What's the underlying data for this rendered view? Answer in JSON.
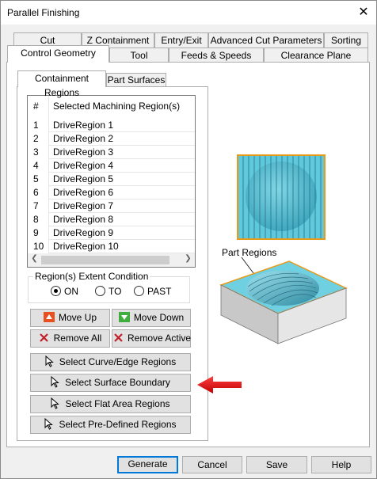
{
  "window": {
    "title": "Parallel Finishing",
    "close_glyph": "✕"
  },
  "tabs_row1": [
    "Cut Parameters",
    "Z Containment",
    "Entry/Exit",
    "Advanced Cut Parameters",
    "Sorting"
  ],
  "tabs_row2": [
    "Control Geometry",
    "Tool",
    "Feeds & Speeds",
    "Clearance Plane"
  ],
  "inner_tabs": [
    "Containment Regions",
    "Part Surfaces"
  ],
  "list": {
    "col_num": "#",
    "col_name": "Selected Machining Region(s)",
    "rows": [
      {
        "num": "1",
        "name": "DriveRegion 1"
      },
      {
        "num": "2",
        "name": "DriveRegion 2"
      },
      {
        "num": "3",
        "name": "DriveRegion 3"
      },
      {
        "num": "4",
        "name": "DriveRegion 4"
      },
      {
        "num": "5",
        "name": "DriveRegion 5"
      },
      {
        "num": "6",
        "name": "DriveRegion 6"
      },
      {
        "num": "7",
        "name": "DriveRegion 7"
      },
      {
        "num": "8",
        "name": "DriveRegion 8"
      },
      {
        "num": "9",
        "name": "DriveRegion 9"
      },
      {
        "num": "10",
        "name": "DriveRegion 10"
      }
    ]
  },
  "extent": {
    "legend": "Region(s) Extent Condition",
    "options": [
      "ON",
      "TO",
      "PAST"
    ],
    "selected": "ON"
  },
  "buttons": {
    "move_up": "Move Up",
    "move_down": "Move Down",
    "remove_all": "Remove All",
    "remove_active": "Remove Active",
    "select_curve": "Select Curve/Edge Regions",
    "select_surface": "Select Surface Boundary",
    "select_flat": "Select Flat Area Regions",
    "select_predefined": "Select Pre-Defined Regions"
  },
  "illustration": {
    "label": "Part Regions"
  },
  "footer": {
    "generate": "Generate",
    "cancel": "Cancel",
    "save": "Save",
    "help": "Help"
  },
  "colors": {
    "accent_blue": "#0078d7",
    "surface_cyan": "#5ec8dc",
    "border_orange": "#e89a1a",
    "arrow_red": "#e01818",
    "up_icon": "#e8501f",
    "down_icon": "#3fae3f",
    "x_icon": "#c0202a"
  }
}
